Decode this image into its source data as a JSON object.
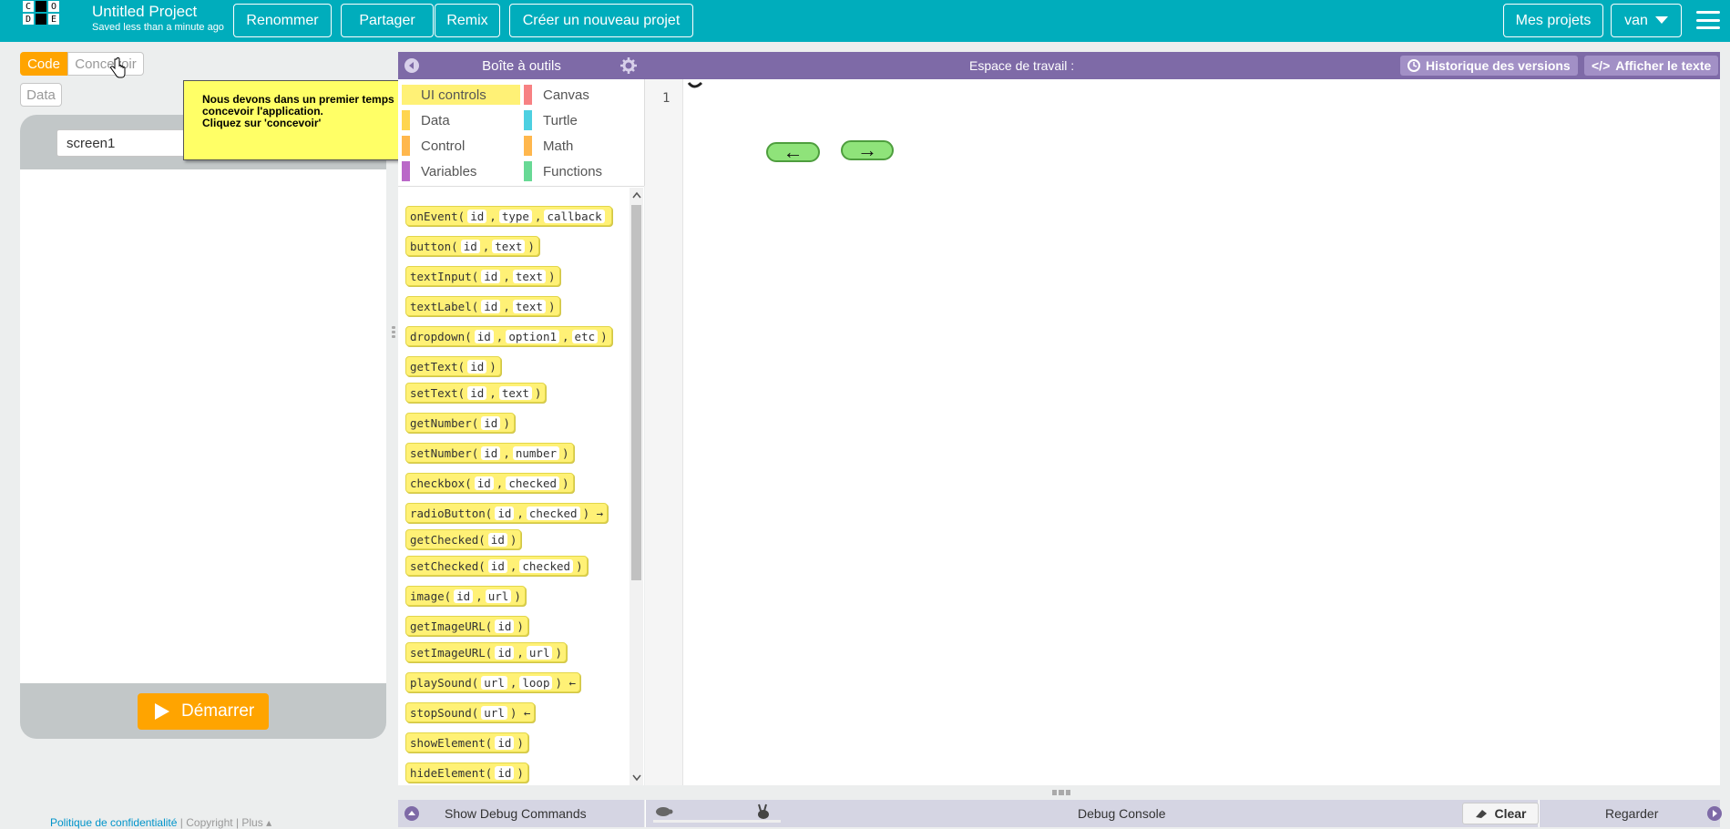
{
  "header": {
    "logo_letters": [
      "C",
      "O",
      "D",
      "E"
    ],
    "project_title": "Untitled Project",
    "saved_status": "Saved less than a minute ago",
    "rename_label": "Renommer",
    "share_label": "Partager",
    "remix_label": "Remix",
    "new_project_label": "Créer un nouveau projet",
    "my_projects_label": "Mes projets",
    "user_label": "van"
  },
  "mode_toggle": {
    "code_label": "Code",
    "design_label": "Concevoir",
    "data_label": "Data"
  },
  "hint": {
    "line1": "Nous devons dans un premier temps",
    "line2": "concevoir l'application.",
    "line3": "Cliquez sur 'concevoir'"
  },
  "app_preview": {
    "screen_selected": "screen1",
    "run_label": "Démarrer"
  },
  "footer": {
    "privacy": "Politique de confidentialité",
    "copyright": "Copyright",
    "more": "Plus"
  },
  "toolbox": {
    "title": "Boîte à outils",
    "categories": [
      {
        "label": "UI controls",
        "color": "#fff176"
      },
      {
        "label": "Canvas",
        "color": "#f78183"
      },
      {
        "label": "Data",
        "color": "#ffd54f"
      },
      {
        "label": "Turtle",
        "color": "#4dd0e1"
      },
      {
        "label": "Control",
        "color": "#ffb74d"
      },
      {
        "label": "Math",
        "color": "#ffb74d"
      },
      {
        "label": "Variables",
        "color": "#ba68c8"
      },
      {
        "label": "Functions",
        "color": "#68d995"
      }
    ],
    "blocks": [
      {
        "name": "onEvent(",
        "params": [
          "id",
          "type",
          "callback"
        ]
      },
      {
        "name": "button(",
        "params": [
          "id",
          "text"
        ],
        "close": ")"
      },
      {
        "name": "textInput(",
        "params": [
          "id",
          "text"
        ],
        "close": ")"
      },
      {
        "name": "textLabel(",
        "params": [
          "id",
          "text"
        ],
        "close": ")"
      },
      {
        "name": "dropdown(",
        "params": [
          "id",
          "option1",
          "etc"
        ],
        "close": ")"
      },
      {
        "name": "getText(",
        "params": [
          "id"
        ],
        "close": ")"
      },
      {
        "name": "setText(",
        "params": [
          "id",
          "text"
        ],
        "close": ")"
      },
      {
        "name": "getNumber(",
        "params": [
          "id"
        ],
        "close": ")"
      },
      {
        "name": "setNumber(",
        "params": [
          "id",
          "number"
        ],
        "close": ")"
      },
      {
        "name": "checkbox(",
        "params": [
          "id",
          "checked"
        ],
        "close": ")"
      },
      {
        "name": "radioButton(",
        "params": [
          "id",
          "checked"
        ],
        "close": ") →"
      },
      {
        "name": "getChecked(",
        "params": [
          "id"
        ],
        "close": ")"
      },
      {
        "name": "setChecked(",
        "params": [
          "id",
          "checked"
        ],
        "close": ")"
      },
      {
        "name": "image(",
        "params": [
          "id",
          "url"
        ],
        "close": ")"
      },
      {
        "name": "getImageURL(",
        "params": [
          "id"
        ],
        "close": ")"
      },
      {
        "name": "setImageURL(",
        "params": [
          "id",
          "url"
        ],
        "close": ")"
      },
      {
        "name": "playSound(",
        "params": [
          "url",
          "loop"
        ],
        "close": ") ←"
      },
      {
        "name": "stopSound(",
        "params": [
          "url"
        ],
        "close": ") ←"
      },
      {
        "name": "showElement(",
        "params": [
          "id"
        ],
        "close": ")"
      },
      {
        "name": "hideElement(",
        "params": [
          "id"
        ],
        "close": ")"
      }
    ]
  },
  "workspace": {
    "title": "Espace de travail :",
    "history_label": "Historique des versions",
    "show_text_label": "Afficher le texte",
    "line_number": "1",
    "left_arrow": "←",
    "right_arrow": "→"
  },
  "debug": {
    "show_commands": "Show Debug Commands",
    "console_title": "Debug Console",
    "clear_label": "Clear",
    "watch_label": "Regarder"
  }
}
